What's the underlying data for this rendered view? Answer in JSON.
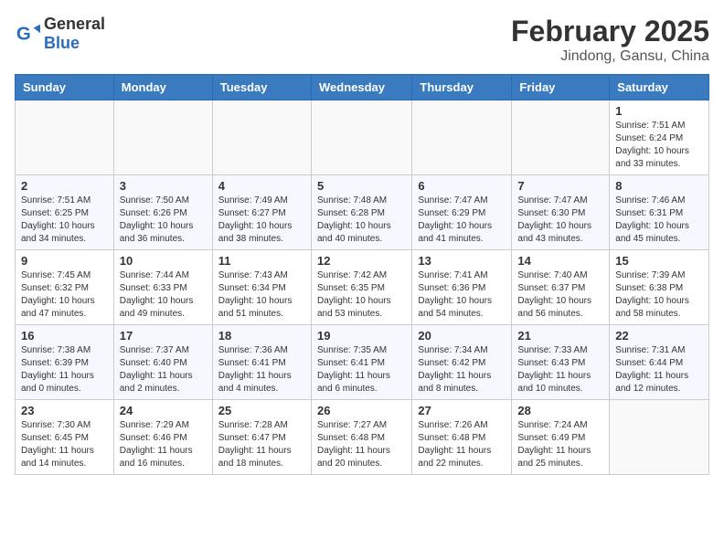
{
  "header": {
    "logo": {
      "general": "General",
      "blue": "Blue"
    },
    "month": "February 2025",
    "location": "Jindong, Gansu, China"
  },
  "weekdays": [
    "Sunday",
    "Monday",
    "Tuesday",
    "Wednesday",
    "Thursday",
    "Friday",
    "Saturday"
  ],
  "weeks": [
    [
      {
        "day": "",
        "info": ""
      },
      {
        "day": "",
        "info": ""
      },
      {
        "day": "",
        "info": ""
      },
      {
        "day": "",
        "info": ""
      },
      {
        "day": "",
        "info": ""
      },
      {
        "day": "",
        "info": ""
      },
      {
        "day": "1",
        "info": "Sunrise: 7:51 AM\nSunset: 6:24 PM\nDaylight: 10 hours and 33 minutes."
      }
    ],
    [
      {
        "day": "2",
        "info": "Sunrise: 7:51 AM\nSunset: 6:25 PM\nDaylight: 10 hours and 34 minutes."
      },
      {
        "day": "3",
        "info": "Sunrise: 7:50 AM\nSunset: 6:26 PM\nDaylight: 10 hours and 36 minutes."
      },
      {
        "day": "4",
        "info": "Sunrise: 7:49 AM\nSunset: 6:27 PM\nDaylight: 10 hours and 38 minutes."
      },
      {
        "day": "5",
        "info": "Sunrise: 7:48 AM\nSunset: 6:28 PM\nDaylight: 10 hours and 40 minutes."
      },
      {
        "day": "6",
        "info": "Sunrise: 7:47 AM\nSunset: 6:29 PM\nDaylight: 10 hours and 41 minutes."
      },
      {
        "day": "7",
        "info": "Sunrise: 7:47 AM\nSunset: 6:30 PM\nDaylight: 10 hours and 43 minutes."
      },
      {
        "day": "8",
        "info": "Sunrise: 7:46 AM\nSunset: 6:31 PM\nDaylight: 10 hours and 45 minutes."
      }
    ],
    [
      {
        "day": "9",
        "info": "Sunrise: 7:45 AM\nSunset: 6:32 PM\nDaylight: 10 hours and 47 minutes."
      },
      {
        "day": "10",
        "info": "Sunrise: 7:44 AM\nSunset: 6:33 PM\nDaylight: 10 hours and 49 minutes."
      },
      {
        "day": "11",
        "info": "Sunrise: 7:43 AM\nSunset: 6:34 PM\nDaylight: 10 hours and 51 minutes."
      },
      {
        "day": "12",
        "info": "Sunrise: 7:42 AM\nSunset: 6:35 PM\nDaylight: 10 hours and 53 minutes."
      },
      {
        "day": "13",
        "info": "Sunrise: 7:41 AM\nSunset: 6:36 PM\nDaylight: 10 hours and 54 minutes."
      },
      {
        "day": "14",
        "info": "Sunrise: 7:40 AM\nSunset: 6:37 PM\nDaylight: 10 hours and 56 minutes."
      },
      {
        "day": "15",
        "info": "Sunrise: 7:39 AM\nSunset: 6:38 PM\nDaylight: 10 hours and 58 minutes."
      }
    ],
    [
      {
        "day": "16",
        "info": "Sunrise: 7:38 AM\nSunset: 6:39 PM\nDaylight: 11 hours and 0 minutes."
      },
      {
        "day": "17",
        "info": "Sunrise: 7:37 AM\nSunset: 6:40 PM\nDaylight: 11 hours and 2 minutes."
      },
      {
        "day": "18",
        "info": "Sunrise: 7:36 AM\nSunset: 6:41 PM\nDaylight: 11 hours and 4 minutes."
      },
      {
        "day": "19",
        "info": "Sunrise: 7:35 AM\nSunset: 6:41 PM\nDaylight: 11 hours and 6 minutes."
      },
      {
        "day": "20",
        "info": "Sunrise: 7:34 AM\nSunset: 6:42 PM\nDaylight: 11 hours and 8 minutes."
      },
      {
        "day": "21",
        "info": "Sunrise: 7:33 AM\nSunset: 6:43 PM\nDaylight: 11 hours and 10 minutes."
      },
      {
        "day": "22",
        "info": "Sunrise: 7:31 AM\nSunset: 6:44 PM\nDaylight: 11 hours and 12 minutes."
      }
    ],
    [
      {
        "day": "23",
        "info": "Sunrise: 7:30 AM\nSunset: 6:45 PM\nDaylight: 11 hours and 14 minutes."
      },
      {
        "day": "24",
        "info": "Sunrise: 7:29 AM\nSunset: 6:46 PM\nDaylight: 11 hours and 16 minutes."
      },
      {
        "day": "25",
        "info": "Sunrise: 7:28 AM\nSunset: 6:47 PM\nDaylight: 11 hours and 18 minutes."
      },
      {
        "day": "26",
        "info": "Sunrise: 7:27 AM\nSunset: 6:48 PM\nDaylight: 11 hours and 20 minutes."
      },
      {
        "day": "27",
        "info": "Sunrise: 7:26 AM\nSunset: 6:48 PM\nDaylight: 11 hours and 22 minutes."
      },
      {
        "day": "28",
        "info": "Sunrise: 7:24 AM\nSunset: 6:49 PM\nDaylight: 11 hours and 25 minutes."
      },
      {
        "day": "",
        "info": ""
      }
    ]
  ]
}
